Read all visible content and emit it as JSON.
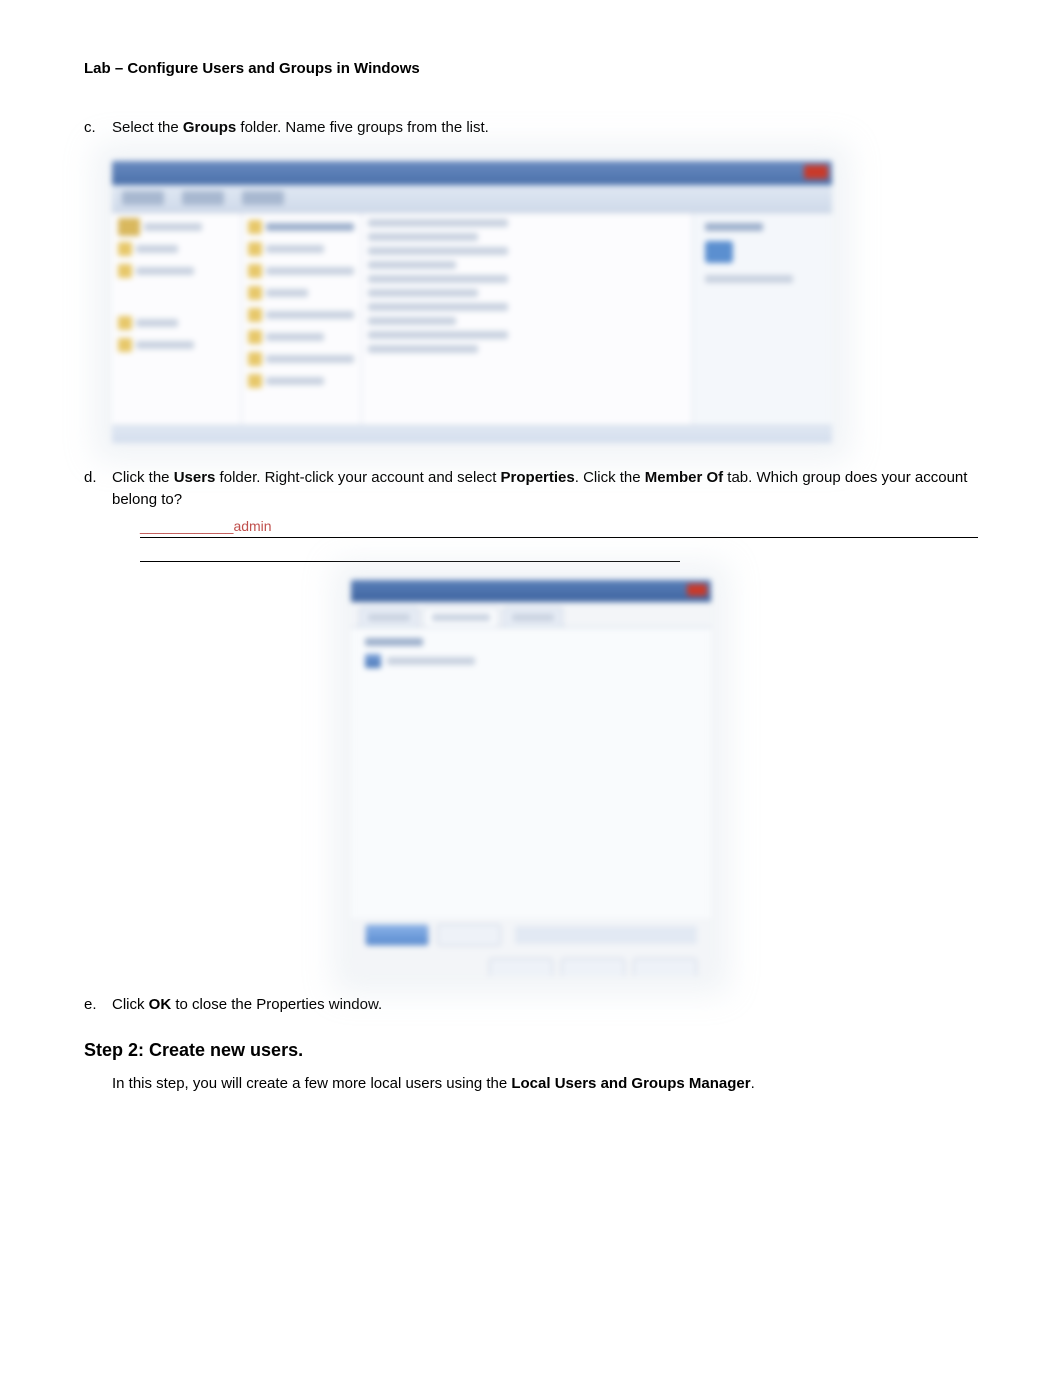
{
  "doc": {
    "title": "Lab – Configure Users and Groups in Windows",
    "item_c": {
      "letter": "c.",
      "text_1": "Select the ",
      "bold_1": "Groups",
      "text_2": " folder. Name five groups from the list."
    },
    "item_d": {
      "letter": "d.",
      "text_1": "Click the ",
      "bold_1": "Users",
      "text_2": " folder. Right-click your account and select ",
      "bold_2": "Properties",
      "text_3": ". Click the ",
      "bold_3": "Member Of",
      "text_4": " tab. Which group does your account belong to?",
      "answer_prefix": "____________",
      "answer_value": "admin"
    },
    "item_e": {
      "letter": "e.",
      "text_1": "Click ",
      "bold_1": "OK",
      "text_2": " to close the Properties window."
    },
    "step2": {
      "heading": "Step 2: Create new users.",
      "text_1": "In this step, you will create a few more local users using the ",
      "bold_1": "Local Users and Groups Manager",
      "text_2": "."
    }
  }
}
